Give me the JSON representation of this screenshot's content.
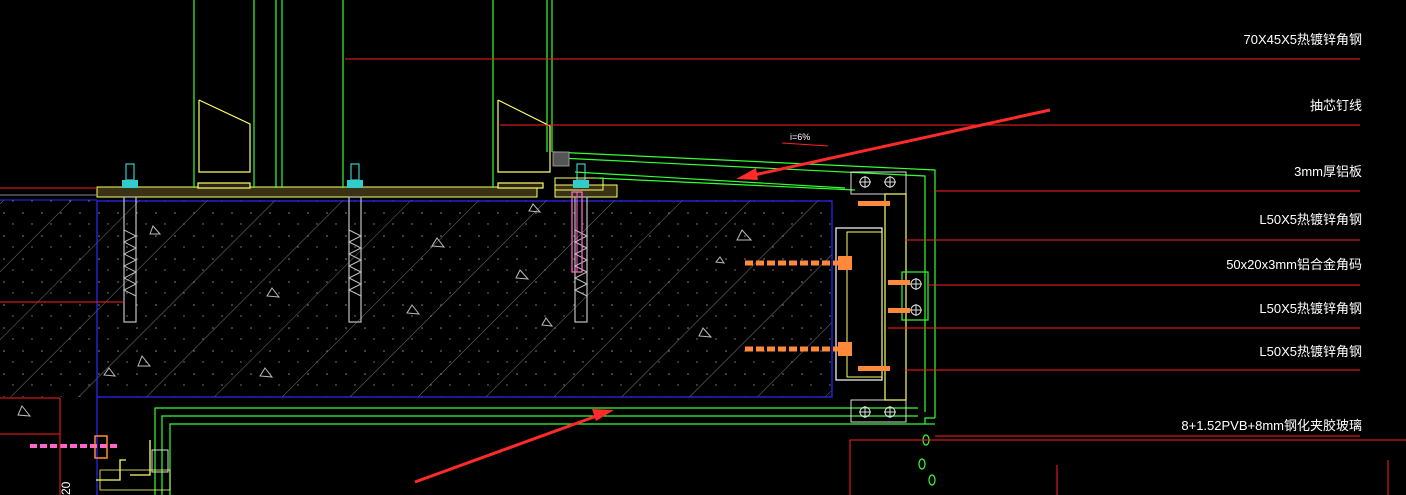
{
  "drawing": {
    "annotations": [
      "70X45X5热镀锌角钢",
      "抽芯钉线",
      "3mm厚铝板",
      "L50X5热镀锌角钢",
      "50x20x3mm铝合金角码",
      "L50X5热镀锌角钢",
      "L50X5热镀锌角钢",
      "8+1.52PVB+8mm钢化夹胶玻璃"
    ],
    "slope_label": "i=6%",
    "partial_dimension": "20",
    "colors": {
      "background": "#000000",
      "leader": "#ff2020",
      "glass_frame": "#33ff33",
      "concrete_outline": "#2a2aff",
      "bracket": "#ffff66",
      "anchor": "#c0c0c0",
      "nut": "#33cccc",
      "bolt_orange": "#ff8a3c",
      "pink_anchor": "#ff66cc",
      "arrow": "#ff2a2a",
      "drip": "#33ff33"
    },
    "icons": [
      "red-arrow-icon",
      "drip-icon",
      "rivet-icon"
    ]
  }
}
